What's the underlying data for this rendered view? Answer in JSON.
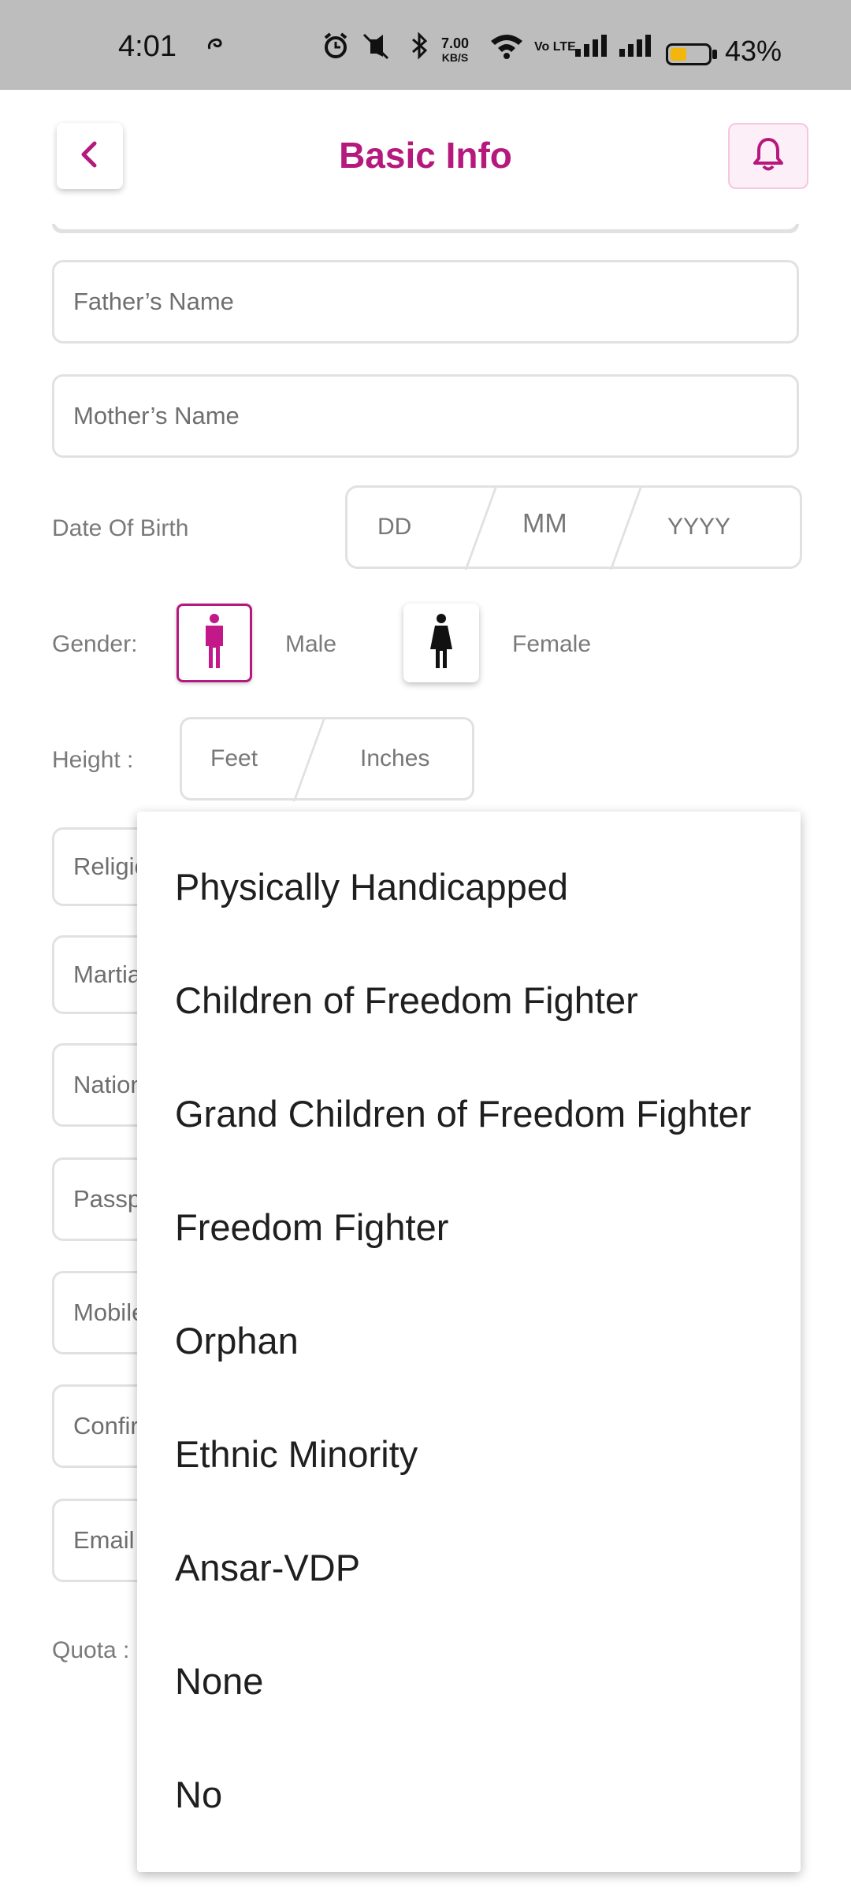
{
  "status_bar": {
    "time": "4:01",
    "speed_value": "7.00",
    "speed_unit": "KB/S",
    "volte": "Vo LTE",
    "battery_percent": "43%",
    "battery_level": 0.43
  },
  "header": {
    "title": "Basic Info",
    "accent_color": "#b5197e"
  },
  "form": {
    "father_name_placeholder": "Father’s Name",
    "mother_name_placeholder": "Mother’s Name",
    "dob_label": "Date Of Birth",
    "dob_dd": "DD",
    "dob_mm": "MM",
    "dob_yyyy": "YYYY",
    "gender_label": "Gender:",
    "gender_male": "Male",
    "gender_female": "Female",
    "height_label": "Height :",
    "height_feet": "Feet",
    "height_inches": "Inches",
    "religion_partial": "Religio",
    "marital_partial": "Martia",
    "nationality_partial": "Nation",
    "passport_partial": "Passp",
    "mobile_partial": "Mobile",
    "confirm_partial": "Confir",
    "email_partial": "Email",
    "quota_label": "Quota :"
  },
  "dropdown": {
    "options": [
      "Physically Handicapped",
      "Children of Freedom Fighter",
      "Grand Children of Freedom Fighter",
      "Freedom Fighter",
      "Orphan",
      "Ethnic Minority",
      "Ansar-VDP",
      "None",
      "No"
    ]
  }
}
